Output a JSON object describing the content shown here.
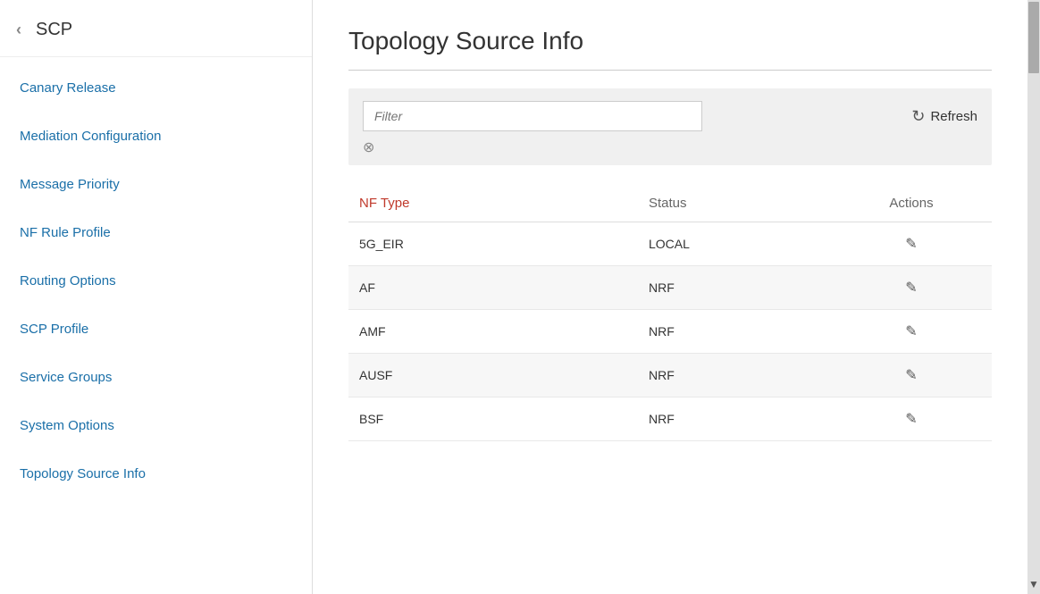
{
  "sidebar": {
    "title": "SCP",
    "back_icon": "‹",
    "items": [
      {
        "label": "Canary Release",
        "id": "canary-release",
        "active": false
      },
      {
        "label": "Mediation Configuration",
        "id": "mediation-configuration",
        "active": false
      },
      {
        "label": "Message Priority",
        "id": "message-priority",
        "active": false
      },
      {
        "label": "NF Rule Profile",
        "id": "nf-rule-profile",
        "active": false
      },
      {
        "label": "Routing Options",
        "id": "routing-options",
        "active": false
      },
      {
        "label": "SCP Profile",
        "id": "scp-profile",
        "active": false
      },
      {
        "label": "Service Groups",
        "id": "service-groups",
        "active": false
      },
      {
        "label": "System Options",
        "id": "system-options",
        "active": false
      },
      {
        "label": "Topology Source Info",
        "id": "topology-source-info",
        "active": true
      }
    ]
  },
  "main": {
    "page_title": "Topology Source Info",
    "filter": {
      "placeholder": "Filter",
      "clear_icon": "⊗"
    },
    "refresh_label": "Refresh",
    "refresh_icon": "↻",
    "table": {
      "columns": [
        {
          "label": "NF Type",
          "key": "nf_type"
        },
        {
          "label": "Status",
          "key": "status"
        },
        {
          "label": "Actions",
          "key": "actions"
        }
      ],
      "rows": [
        {
          "nf_type": "5G_EIR",
          "status": "LOCAL"
        },
        {
          "nf_type": "AF",
          "status": "NRF"
        },
        {
          "nf_type": "AMF",
          "status": "NRF"
        },
        {
          "nf_type": "AUSF",
          "status": "NRF"
        },
        {
          "nf_type": "BSF",
          "status": "NRF"
        }
      ]
    }
  },
  "colors": {
    "link": "#1a6fa8",
    "header_nftype": "#c0392b",
    "background_filter": "#f0f0f0",
    "row_even": "#f7f7f7"
  }
}
